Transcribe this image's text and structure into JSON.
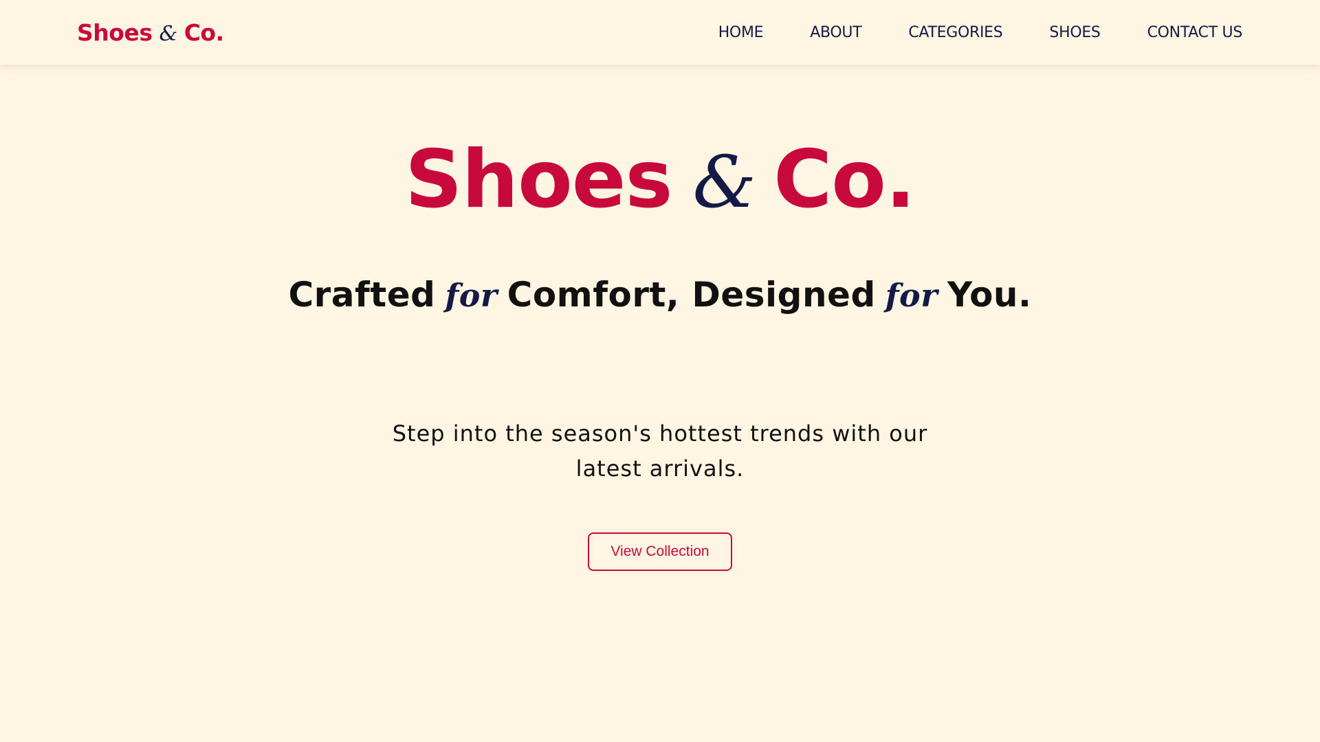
{
  "nav": {
    "brand": {
      "word1": "Shoes",
      "amp": "&",
      "word2": "Co."
    },
    "links": [
      "HOME",
      "ABOUT",
      "CATEGORIES",
      "SHOES",
      "CONTACT US"
    ]
  },
  "hero": {
    "title": {
      "word1": "Shoes",
      "amp": "&",
      "word2": "Co."
    },
    "tagline": {
      "part1": "Crafted",
      "script1": "for",
      "part2": "Comfort, Designed",
      "script2": "for",
      "part3": "You."
    },
    "description": "Step into the season's hottest trends with our latest arrivals.",
    "cta_label": "View Collection"
  },
  "colors": {
    "background": "#FFF5E2",
    "brand_red": "#C8093C",
    "navy": "#131A45",
    "text": "#111111"
  }
}
